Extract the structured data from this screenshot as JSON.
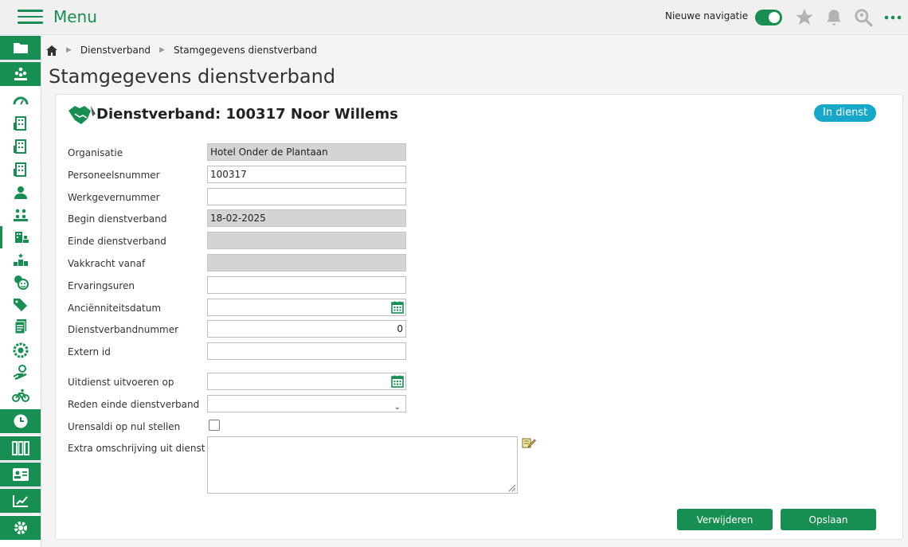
{
  "app": {
    "menu_title": "Menu",
    "nav_toggle_label": "Nieuwe navigatie"
  },
  "breadcrumb": {
    "items": [
      "Dienstverband",
      "Stamgegevens dienstverband"
    ]
  },
  "page": {
    "title": "Stamgegevens dienstverband"
  },
  "panel": {
    "title": "Dienstverband: 100317 Noor Willems",
    "status": "In dienst"
  },
  "form": {
    "labels": {
      "organisatie": "Organisatie",
      "personeelsnummer": "Personeelsnummer",
      "werkgevernummer": "Werkgevernummer",
      "begin": "Begin dienstverband",
      "einde": "Einde dienstverband",
      "vakkracht": "Vakkracht vanaf",
      "ervaringsuren": "Ervaringsuren",
      "anciennniteit": "Anciënniteitsdatum",
      "dienstverbandnummer": "Dienstverbandnummer",
      "extern_id": "Extern id",
      "uitdienst": "Uitdienst uitvoeren op",
      "reden": "Reden einde dienstverband",
      "urensaldi": "Urensaldi op nul stellen",
      "extra": "Extra omschrijving uit dienst"
    },
    "values": {
      "organisatie": "Hotel Onder de Plantaan",
      "personeelsnummer": "100317",
      "werkgevernummer": "",
      "begin": "18-02-2025",
      "einde": "",
      "vakkracht": "",
      "ervaringsuren": "",
      "anciennniteit": "",
      "dienstverbandnummer": "0",
      "extern_id": "",
      "uitdienst": "",
      "reden": "",
      "urensaldi_checked": false,
      "extra": ""
    }
  },
  "buttons": {
    "delete": "Verwijderen",
    "save": "Opslaan"
  },
  "colors": {
    "brand_green": "#178f52",
    "status_badge": "#17a8c9",
    "readonly_field": "#d4d4d4"
  },
  "icons": {
    "topbar": [
      "star-icon",
      "bell-icon",
      "search-icon",
      "more-icon"
    ],
    "sidebar": [
      "folder-icon",
      "people-icon",
      "dashboard-icon",
      "building-icon",
      "building-icon",
      "building-icon",
      "person-icon",
      "team-icon",
      "org-person-icon",
      "ranking-icon",
      "face-icon",
      "tag-icon",
      "document-icon",
      "badge-icon",
      "hand-person-icon",
      "bike-icon",
      "clock-icon",
      "columns-icon",
      "id-card-icon",
      "chart-edit-icon",
      "settings-icon"
    ]
  }
}
